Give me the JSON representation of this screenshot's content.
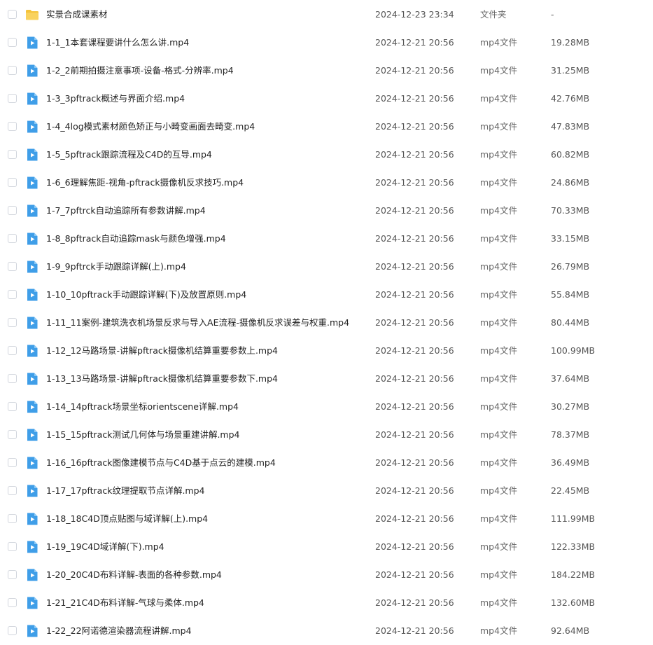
{
  "colors": {
    "folder_icon": "#f5c33b",
    "video_icon": "#3f9ee8",
    "checkbox_border": "#d2d6dd"
  },
  "files": [
    {
      "icon": "folder-icon",
      "name": "实景合成课素材",
      "date": "2024-12-23 23:34",
      "type": "文件夹",
      "size": "-"
    },
    {
      "icon": "video-file-icon",
      "name": "1-1_1本套课程要讲什么怎么讲.mp4",
      "date": "2024-12-21 20:56",
      "type": "mp4文件",
      "size": "19.28MB"
    },
    {
      "icon": "video-file-icon",
      "name": "1-2_2前期拍摄注意事项-设备-格式-分辨率.mp4",
      "date": "2024-12-21 20:56",
      "type": "mp4文件",
      "size": "31.25MB"
    },
    {
      "icon": "video-file-icon",
      "name": "1-3_3pftrack概述与界面介绍.mp4",
      "date": "2024-12-21 20:56",
      "type": "mp4文件",
      "size": "42.76MB"
    },
    {
      "icon": "video-file-icon",
      "name": "1-4_4log模式素材颜色矫正与小畸变画面去畸变.mp4",
      "date": "2024-12-21 20:56",
      "type": "mp4文件",
      "size": "47.83MB"
    },
    {
      "icon": "video-file-icon",
      "name": "1-5_5pftrack跟踪流程及C4D的互导.mp4",
      "date": "2024-12-21 20:56",
      "type": "mp4文件",
      "size": "60.82MB"
    },
    {
      "icon": "video-file-icon",
      "name": "1-6_6理解焦距-视角-pftrack摄像机反求技巧.mp4",
      "date": "2024-12-21 20:56",
      "type": "mp4文件",
      "size": "24.86MB"
    },
    {
      "icon": "video-file-icon",
      "name": "1-7_7pftrck自动追踪所有参数讲解.mp4",
      "date": "2024-12-21 20:56",
      "type": "mp4文件",
      "size": "70.33MB"
    },
    {
      "icon": "video-file-icon",
      "name": "1-8_8pftrack自动追踪mask与颜色增强.mp4",
      "date": "2024-12-21 20:56",
      "type": "mp4文件",
      "size": "33.15MB"
    },
    {
      "icon": "video-file-icon",
      "name": "1-9_9pftrck手动跟踪详解(上).mp4",
      "date": "2024-12-21 20:56",
      "type": "mp4文件",
      "size": "26.79MB"
    },
    {
      "icon": "video-file-icon",
      "name": "1-10_10pftrack手动跟踪详解(下)及放置原则.mp4",
      "date": "2024-12-21 20:56",
      "type": "mp4文件",
      "size": "55.84MB"
    },
    {
      "icon": "video-file-icon",
      "name": "1-11_11案例-建筑洗衣机场景反求与导入AE流程-摄像机反求误差与权重.mp4",
      "date": "2024-12-21 20:56",
      "type": "mp4文件",
      "size": "80.44MB"
    },
    {
      "icon": "video-file-icon",
      "name": "1-12_12马路场景-讲解pftrack摄像机结算重要参数上.mp4",
      "date": "2024-12-21 20:56",
      "type": "mp4文件",
      "size": "100.99MB"
    },
    {
      "icon": "video-file-icon",
      "name": "1-13_13马路场景-讲解pftrack摄像机结算重要参数下.mp4",
      "date": "2024-12-21 20:56",
      "type": "mp4文件",
      "size": "37.64MB"
    },
    {
      "icon": "video-file-icon",
      "name": "1-14_14pftrack场景坐标orientscene详解.mp4",
      "date": "2024-12-21 20:56",
      "type": "mp4文件",
      "size": "30.27MB"
    },
    {
      "icon": "video-file-icon",
      "name": "1-15_15pftrack测试几何体与场景重建讲解.mp4",
      "date": "2024-12-21 20:56",
      "type": "mp4文件",
      "size": "78.37MB"
    },
    {
      "icon": "video-file-icon",
      "name": "1-16_16pftrack图像建模节点与C4D基于点云的建模.mp4",
      "date": "2024-12-21 20:56",
      "type": "mp4文件",
      "size": "36.49MB"
    },
    {
      "icon": "video-file-icon",
      "name": "1-17_17pftrack纹理提取节点详解.mp4",
      "date": "2024-12-21 20:56",
      "type": "mp4文件",
      "size": "22.45MB"
    },
    {
      "icon": "video-file-icon",
      "name": "1-18_18C4D顶点贴图与域详解(上).mp4",
      "date": "2024-12-21 20:56",
      "type": "mp4文件",
      "size": "111.99MB"
    },
    {
      "icon": "video-file-icon",
      "name": "1-19_19C4D域详解(下).mp4",
      "date": "2024-12-21 20:56",
      "type": "mp4文件",
      "size": "122.33MB"
    },
    {
      "icon": "video-file-icon",
      "name": "1-20_20C4D布料详解-表面的各种参数.mp4",
      "date": "2024-12-21 20:56",
      "type": "mp4文件",
      "size": "184.22MB"
    },
    {
      "icon": "video-file-icon",
      "name": "1-21_21C4D布料详解-气球与柔体.mp4",
      "date": "2024-12-21 20:56",
      "type": "mp4文件",
      "size": "132.60MB"
    },
    {
      "icon": "video-file-icon",
      "name": "1-22_22阿诺德渲染器流程讲解.mp4",
      "date": "2024-12-21 20:56",
      "type": "mp4文件",
      "size": "92.64MB"
    }
  ]
}
